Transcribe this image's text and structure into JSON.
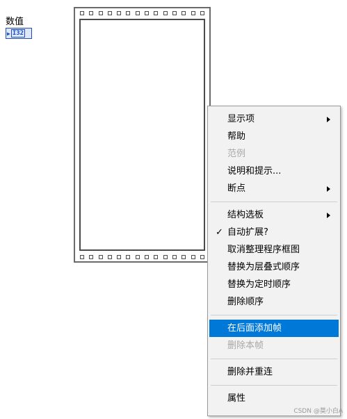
{
  "numeric": {
    "label": "数值",
    "type_tag": "I32"
  },
  "menu": {
    "groups": [
      [
        {
          "label": "显示项",
          "submenu": true
        },
        {
          "label": "帮助"
        },
        {
          "label": "范例",
          "disabled": true
        },
        {
          "label": "说明和提示..."
        },
        {
          "label": "断点",
          "submenu": true
        }
      ],
      [
        {
          "label": "结构选板",
          "submenu": true
        },
        {
          "label": "自动扩展?",
          "checked": true
        },
        {
          "label": "取消整理程序框图"
        },
        {
          "label": "替换为层叠式顺序"
        },
        {
          "label": "替换为定时顺序"
        },
        {
          "label": "删除顺序"
        }
      ],
      [
        {
          "label": "在后面添加帧",
          "highlighted": true
        },
        {
          "label": "删除本帧",
          "disabled": true
        }
      ],
      [
        {
          "label": "删除并重连"
        }
      ],
      [
        {
          "label": "属性"
        }
      ]
    ],
    "check_glyph": "✓"
  },
  "watermark": "CSDN @莫小白A"
}
